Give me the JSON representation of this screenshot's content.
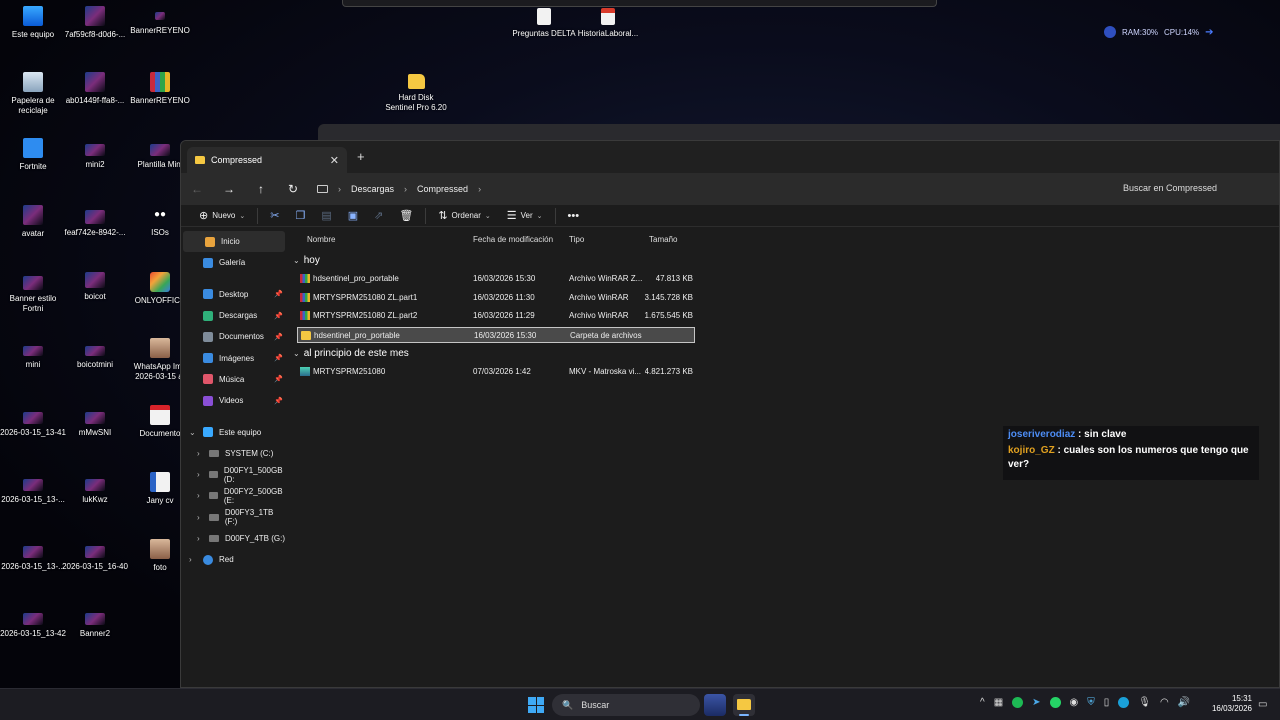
{
  "desktop": {
    "icons": [
      {
        "label": "Este equipo",
        "kind": "pc"
      },
      {
        "label": "7af59cf8-d0d6-...",
        "kind": "img"
      },
      {
        "label": "BannerREYENO",
        "kind": "img"
      },
      {
        "label": "Papelera de reciclaje",
        "kind": "bin"
      },
      {
        "label": "ab01449f-ffa8-...",
        "kind": "img"
      },
      {
        "label": "BannerREYENO",
        "kind": "rar"
      },
      {
        "label": "Fortnite",
        "kind": "fortnite"
      },
      {
        "label": "mini2",
        "kind": "img"
      },
      {
        "label": "Plantilla Mini",
        "kind": "img"
      },
      {
        "label": "avatar",
        "kind": "img"
      },
      {
        "label": "feaf742e-8942-...",
        "kind": "img"
      },
      {
        "label": "ISOs",
        "kind": "eyes"
      },
      {
        "label": "Banner estilo Fortni",
        "kind": "img"
      },
      {
        "label": "boicot",
        "kind": "img"
      },
      {
        "label": "ONLYOFFICE",
        "kind": "office"
      },
      {
        "label": "mini",
        "kind": "img"
      },
      {
        "label": "boicotmini",
        "kind": "img"
      },
      {
        "label": "WhatsApp Ima 2026-03-15 at",
        "kind": "photo"
      },
      {
        "label": "2026-03-15_13-41",
        "kind": "img"
      },
      {
        "label": "mMwSNI",
        "kind": "img"
      },
      {
        "label": "Documento",
        "kind": "pdfr"
      },
      {
        "label": "2026-03-15_13-...",
        "kind": "img"
      },
      {
        "label": "lukKwz",
        "kind": "img"
      },
      {
        "label": "Jany cv",
        "kind": "wdoc"
      },
      {
        "label": "2026-03-15_13-...",
        "kind": "img"
      },
      {
        "label": "2026-03-15_16-40",
        "kind": "img"
      },
      {
        "label": "foto",
        "kind": "photo"
      },
      {
        "label": "2026-03-15_13-42",
        "kind": "img"
      },
      {
        "label": "Banner2",
        "kind": "img"
      },
      {
        "label": "Preguntas DELTA",
        "kind": "doc"
      },
      {
        "label": "HistoriaLaboral...",
        "kind": "pdf"
      },
      {
        "label": "Hard Disk Sentinel Pro 6.20",
        "kind": "folder"
      }
    ],
    "monitor": {
      "ram": "RAM:30%",
      "cpu": "CPU:14%"
    }
  },
  "explorer": {
    "tab_title": "Compressed",
    "breadcrumb": [
      "Descargas",
      "Compressed"
    ],
    "search_placeholder": "Buscar en Compressed",
    "toolbar": {
      "new": "Nuevo",
      "sort": "Ordenar",
      "view": "Ver"
    },
    "sidebar": {
      "quick": [
        {
          "label": "Inicio",
          "color": "#e8a33d"
        },
        {
          "label": "Galería",
          "color": "#3a8be0"
        }
      ],
      "pinned": [
        {
          "label": "Desktop",
          "color": "#3a8be0"
        },
        {
          "label": "Descargas",
          "color": "#2fb07a"
        },
        {
          "label": "Documentos",
          "color": "#7f8c9a"
        },
        {
          "label": "Imágenes",
          "color": "#3a8be0"
        },
        {
          "label": "Música",
          "color": "#e0566a"
        },
        {
          "label": "Videos",
          "color": "#8a4fd6"
        }
      ],
      "this_pc": "Este equipo",
      "drives": [
        "SYSTEM (C:)",
        "D00FY1_500GB (D:",
        "D00FY2_500GB (E:",
        "D00FY3_1TB (F:)",
        "D00FY_4TB (G:)"
      ],
      "network": "Red"
    },
    "columns": [
      "Nombre",
      "Fecha de modificación",
      "Tipo",
      "Tamaño"
    ],
    "groups": [
      {
        "name": "hoy",
        "rows": [
          {
            "name": "hdsentinel_pro_portable",
            "date": "16/03/2026 15:30",
            "type": "Archivo WinRAR Z...",
            "size": "47.813 KB",
            "icon": "rar"
          },
          {
            "name": "MRTYSPRM251080 ZL.part1",
            "date": "16/03/2026 11:30",
            "type": "Archivo WinRAR",
            "size": "3.145.728 KB",
            "icon": "rar"
          },
          {
            "name": "MRTYSPRM251080 ZL.part2",
            "date": "16/03/2026 11:29",
            "type": "Archivo WinRAR",
            "size": "1.675.545 KB",
            "icon": "rar"
          },
          {
            "name": "hdsentinel_pro_portable",
            "date": "16/03/2026 15:30",
            "type": "Carpeta de archivos",
            "size": "",
            "icon": "fold",
            "selected": true
          }
        ]
      },
      {
        "name": "al principio de este mes",
        "rows": [
          {
            "name": "MRTYSPRM251080",
            "date": "07/03/2026 1:42",
            "type": "MKV - Matroska vi...",
            "size": "4.821.273 KB",
            "icon": "mkv"
          }
        ]
      }
    ]
  },
  "chat": [
    {
      "user": "joseriverodiaz",
      "message": "sin clave"
    },
    {
      "user": "kojiro_GZ",
      "message": "cuales son los numeros que tengo que ver?"
    }
  ],
  "taskbar": {
    "search": "Buscar",
    "time": "15:31",
    "date": "16/03/2026"
  }
}
